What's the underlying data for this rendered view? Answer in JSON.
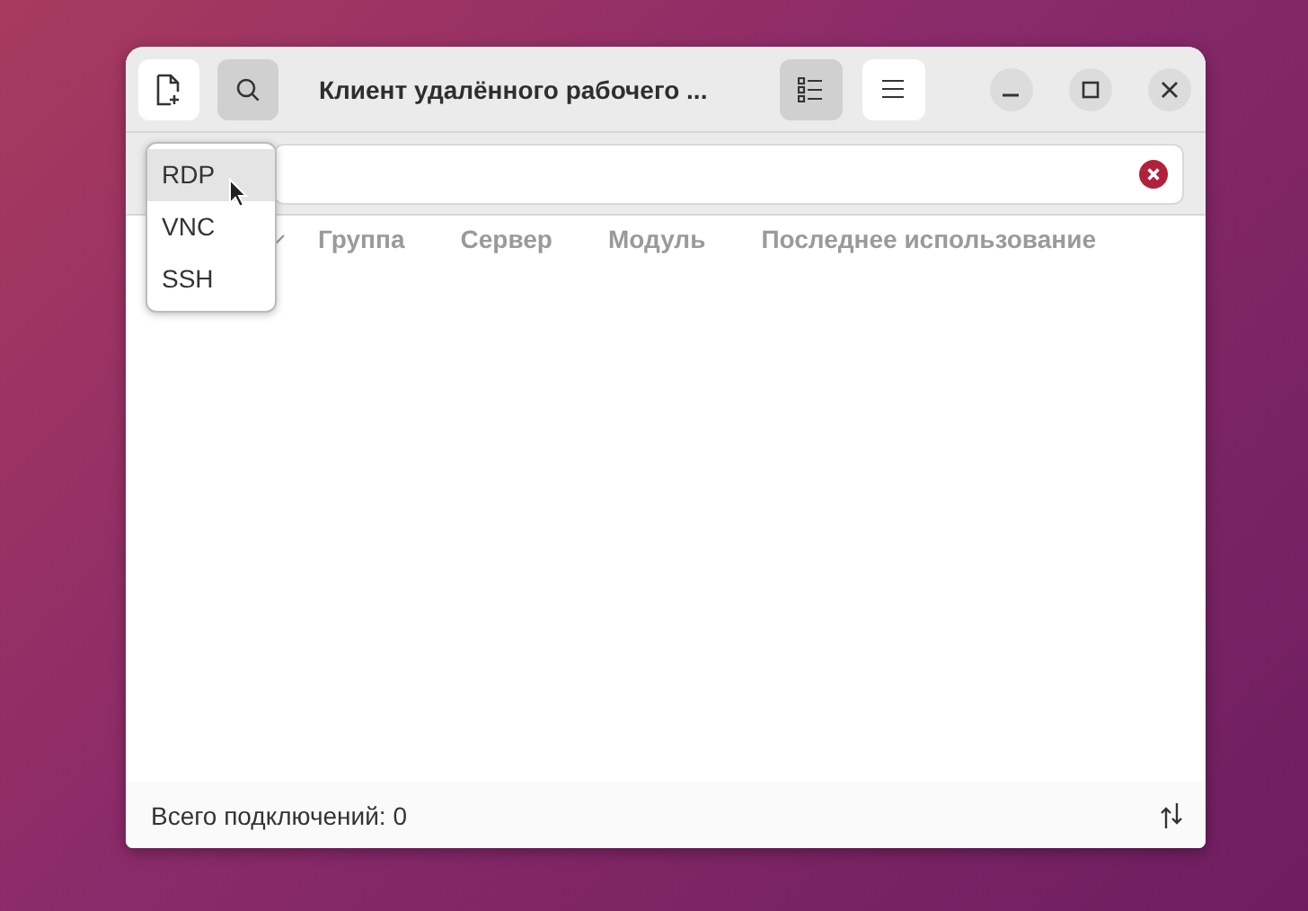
{
  "window": {
    "title": "Клиент удалённого рабочего ..."
  },
  "header_buttons": [
    {
      "kind": "new",
      "pressed": false
    },
    {
      "kind": "search",
      "pressed": true
    }
  ],
  "view_buttons": [
    {
      "kind": "list",
      "pressed": true
    },
    {
      "kind": "menu",
      "pressed": false
    }
  ],
  "search": {
    "clear": true
  },
  "protocol_menu": [
    {
      "label": "RDP",
      "selected": true
    },
    {
      "label": "VNC",
      "selected": false
    },
    {
      "label": "SSH",
      "selected": false
    }
  ],
  "table": {
    "columns": [
      {
        "sorted": true
      },
      {
        "label": "Группа",
        "sorted": false
      },
      {
        "label": "Сервер",
        "sorted": false
      },
      {
        "label": "Модуль",
        "sorted": false
      },
      {
        "label": "Последнее использование",
        "sorted": false
      }
    ]
  },
  "status_bar": {
    "text": "Всего подключений: 0"
  }
}
